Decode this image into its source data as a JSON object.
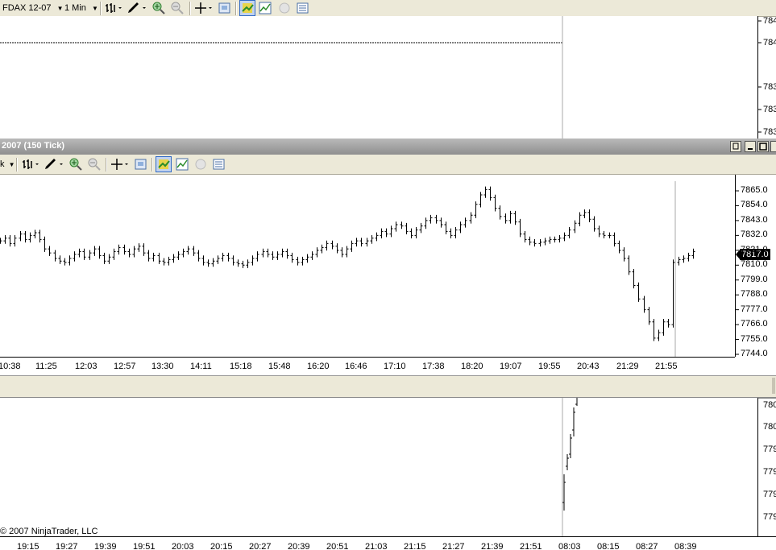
{
  "top_window": {
    "toolbar": {
      "instrument": "FDAX 12-07",
      "interval": "1 Min"
    },
    "price_labels": [
      "784",
      "784",
      "783",
      "783",
      "783"
    ],
    "price_marker_dashed": true
  },
  "middle_window": {
    "title": "2007  (150 Tick)",
    "toolbar": {
      "instrument_tail": "k"
    },
    "last_price": "7817.0",
    "chart_data": {
      "type": "ohlc-bar",
      "y_axis": [
        "7865.0",
        "7854.0",
        "7843.0",
        "7832.0",
        "7821.0",
        "7810.0",
        "7799.0",
        "7788.0",
        "7777.0",
        "7766.0",
        "7755.0",
        "7744.0"
      ],
      "ylim": [
        7744,
        7870
      ],
      "x_labels": [
        "10:38",
        "11:25",
        "12:03",
        "12:57",
        "13:30",
        "14:11",
        "15:18",
        "15:48",
        "16:20",
        "16:46",
        "17:10",
        "17:38",
        "18:20",
        "19:07",
        "19:55",
        "20:43",
        "21:29",
        "21:55"
      ],
      "closes": [
        7828,
        7830,
        7826,
        7830,
        7833,
        7829,
        7832,
        7834,
        7829,
        7822,
        7819,
        7815,
        7813,
        7812,
        7815,
        7818,
        7820,
        7816,
        7819,
        7822,
        7817,
        7813,
        7816,
        7820,
        7823,
        7820,
        7818,
        7822,
        7824,
        7819,
        7815,
        7817,
        7813,
        7812,
        7814,
        7816,
        7818,
        7820,
        7822,
        7819,
        7815,
        7812,
        7811,
        7813,
        7815,
        7817,
        7815,
        7812,
        7811,
        7810,
        7812,
        7815,
        7818,
        7820,
        7818,
        7816,
        7818,
        7820,
        7817,
        7814,
        7812,
        7814,
        7816,
        7818,
        7821,
        7823,
        7826,
        7824,
        7821,
        7818,
        7822,
        7826,
        7828,
        7826,
        7828,
        7830,
        7832,
        7835,
        7833,
        7837,
        7840,
        7839,
        7835,
        7832,
        7836,
        7839,
        7843,
        7845,
        7843,
        7840,
        7835,
        7832,
        7836,
        7840,
        7843,
        7847,
        7855,
        7862,
        7866,
        7860,
        7852,
        7846,
        7843,
        7848,
        7842,
        7833,
        7829,
        7827,
        7826,
        7827,
        7828,
        7829,
        7829,
        7830,
        7832,
        7836,
        7841,
        7847,
        7849,
        7844,
        7837,
        7833,
        7832,
        7832,
        7826,
        7821,
        7815,
        7805,
        7795,
        7785,
        7777,
        7768,
        7756,
        7760,
        7768,
        7766,
        7812,
        7814,
        7815,
        7817,
        7820
      ]
    }
  },
  "bottom_window": {
    "price_labels": [
      "780",
      "780",
      "779",
      "779",
      "779",
      "779"
    ],
    "copyright": "© 2007 NinjaTrader, LLC",
    "x_labels": [
      "19:15",
      "19:27",
      "19:39",
      "19:51",
      "20:03",
      "20:15",
      "20:27",
      "20:39",
      "20:51",
      "21:03",
      "21:15",
      "21:27",
      "21:39",
      "21:51",
      "08:03",
      "08:15",
      "08:27",
      "08:39"
    ]
  }
}
